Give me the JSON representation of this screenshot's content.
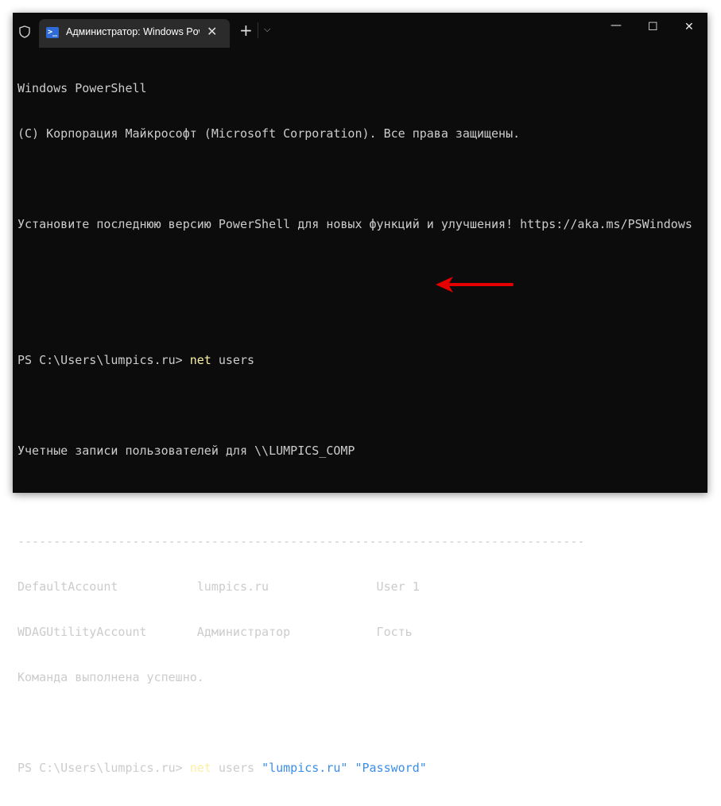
{
  "window": {
    "tab_title": "Администратор: Windows PowerShell",
    "tab_icon": "powershell-icon",
    "controls": {
      "minimize": "—",
      "maximize": "☐",
      "close": "✕"
    },
    "new_tab": "+",
    "dropdown": "⌵",
    "tab_close": "✕"
  },
  "terminal": {
    "lines": [
      "Windows PowerShell",
      "(C) Корпорация Майкрософт (Microsoft Corporation). Все права защищены.",
      "",
      "Установите последнюю версию PowerShell для новых функций и улучшения! https://aka.ms/PSWindows",
      "",
      "",
      "PS C:\\Users\\lumpics.ru> ",
      "",
      "Учетные записи пользователей для \\\\LUMPICS_COMP",
      "",
      "-------------------------------------------------------------------------------",
      "DefaultAccount           lumpics.ru               User 1",
      "WDAGUtilityAccount       Администратор            Гость",
      "Команда выполнена успешно.",
      "",
      "PS C:\\Users\\lumpics.ru> "
    ],
    "cmd1": {
      "command": "net",
      "args": " users"
    },
    "cmd2": {
      "command": "net",
      "args": " users ",
      "arg1": "\"lumpics.ru\"",
      "space": " ",
      "arg2": "\"Password\""
    }
  },
  "annotation": {
    "arrow_color": "#e50000"
  }
}
